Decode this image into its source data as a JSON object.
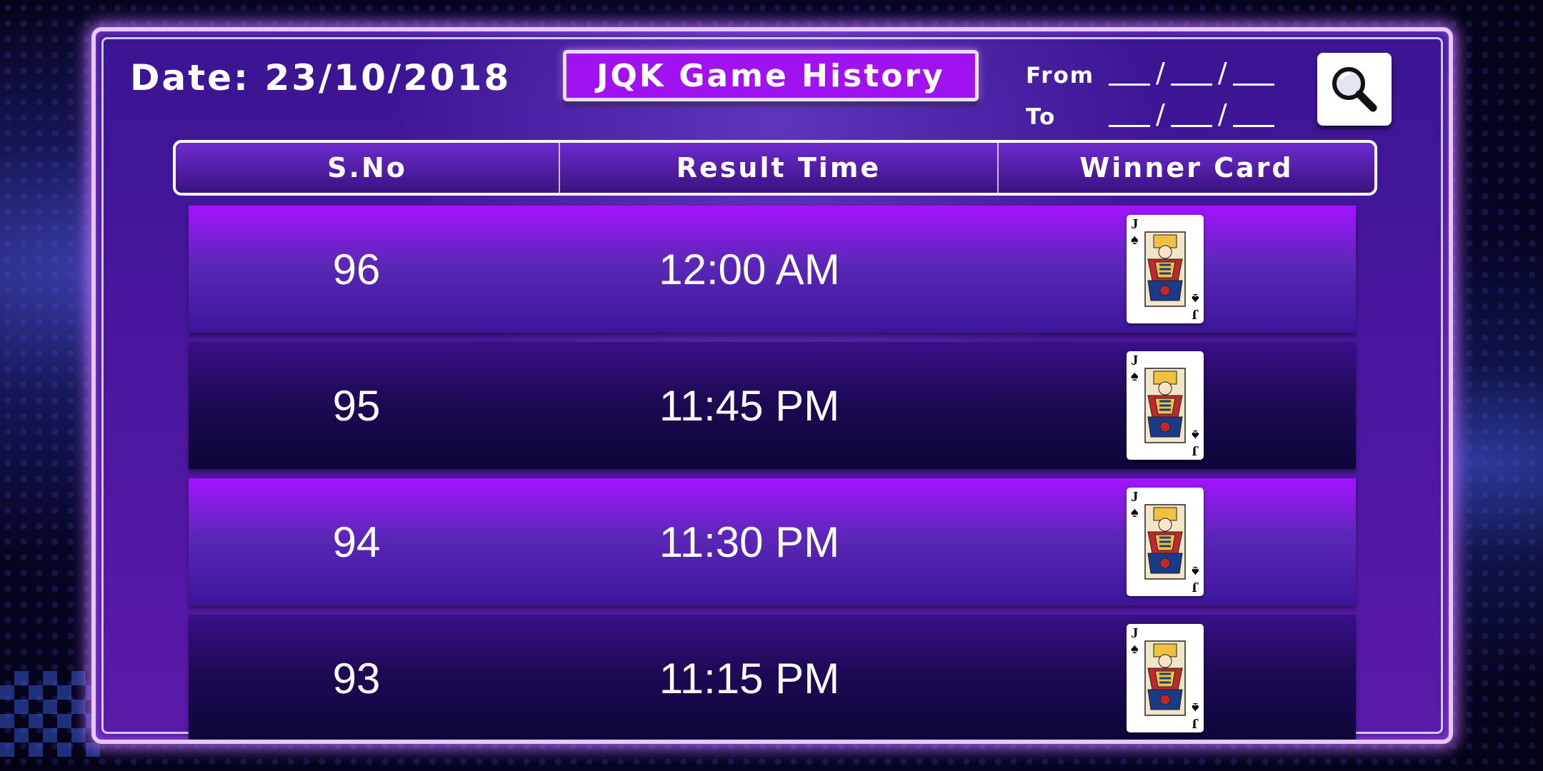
{
  "header": {
    "date_text": "Date: 23/10/2018",
    "title": "JQK Game History",
    "from_label": "From",
    "to_label": "To",
    "date_separator": "/"
  },
  "search": {
    "icon": "search-icon"
  },
  "table": {
    "columns": [
      "S.No",
      "Result Time",
      "Winner Card"
    ],
    "rows": [
      {
        "sno": "96",
        "time": "12:00 AM",
        "card_rank": "J",
        "card_suit": "♠"
      },
      {
        "sno": "95",
        "time": "11:45 PM",
        "card_rank": "J",
        "card_suit": "♠"
      },
      {
        "sno": "94",
        "time": "11:30 PM",
        "card_rank": "J",
        "card_suit": "♠"
      },
      {
        "sno": "93",
        "time": "11:15 PM",
        "card_rank": "J",
        "card_suit": "♠"
      }
    ]
  },
  "colors": {
    "accent": "#a012f0",
    "panel": "#4a179e",
    "row_bright": "#a313ff",
    "row_dark": "#1d0a56"
  }
}
